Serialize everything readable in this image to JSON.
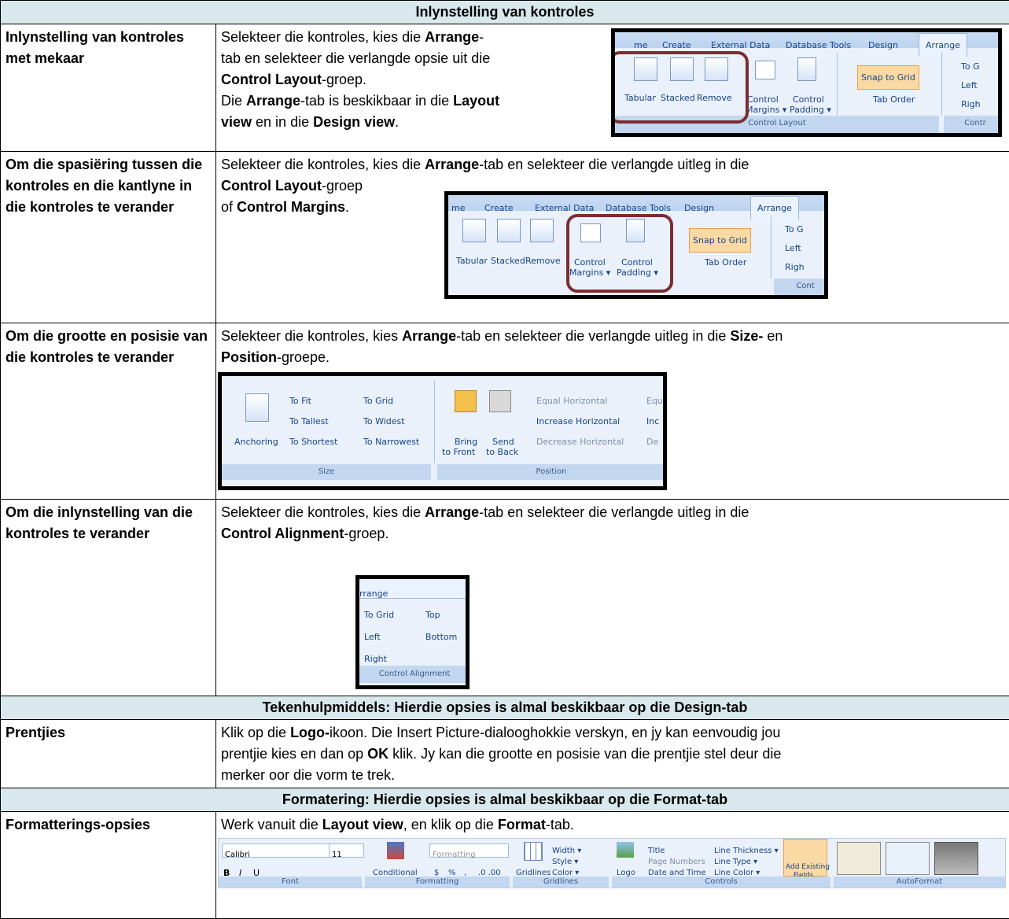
{
  "title": "Inlynstelling van kontroles",
  "rows": [
    {
      "label": "Inlynstelling van kontroles met mekaar",
      "lines": [
        [
          {
            "t": "Selekteer die kontroles, kies die "
          },
          {
            "t": "Arrange",
            "b": true
          },
          {
            "t": "-"
          }
        ],
        [
          {
            "t": "tab en selekteer die verlangde opsie uit die"
          }
        ],
        [
          {
            "t": "Control Layout",
            "b": true
          },
          {
            "t": "-groep."
          }
        ],
        [
          {
            "t": "Die "
          },
          {
            "t": "Arrange",
            "b": true
          },
          {
            "t": "-tab is beskikbaar in die "
          },
          {
            "t": "Layout",
            "b": true
          }
        ],
        [
          {
            "t": "view",
            "b": true
          },
          {
            "t": " en in die "
          },
          {
            "t": "Design view",
            "b": true
          },
          {
            "t": "."
          }
        ]
      ]
    },
    {
      "label": "Om die spasiëring tussen die kontroles en die kantlyne in die kontroles te verander",
      "lines": [
        [
          {
            "t": "Selekteer die kontroles, kies die "
          },
          {
            "t": "Arrange",
            "b": true
          },
          {
            "t": "-tab en selekteer die verlangde uitleg in die"
          }
        ],
        [
          {
            "t": "Control Layout",
            "b": true
          },
          {
            "t": "-groep"
          }
        ],
        [
          {
            "t": "of "
          },
          {
            "t": "Control Margins",
            "b": true
          },
          {
            "t": "."
          }
        ]
      ]
    },
    {
      "label": "Om die grootte en posisie van die kontroles te verander",
      "lines": [
        [
          {
            "t": "Selekteer die kontroles, kies "
          },
          {
            "t": "Arrange",
            "b": true
          },
          {
            "t": "-tab en selekteer die verlangde uitleg in die "
          },
          {
            "t": "Size-",
            "b": true
          },
          {
            "t": " en"
          }
        ],
        [
          {
            "t": "Position",
            "b": true
          },
          {
            "t": "-groepe."
          }
        ]
      ]
    },
    {
      "label": "Om die inlynstelling van die kontroles te verander",
      "lines": [
        [
          {
            "t": "Selekteer die kontroles, kies die "
          },
          {
            "t": "Arrange",
            "b": true
          },
          {
            "t": "-tab en selekteer die verlangde uitleg in die"
          }
        ],
        [
          {
            "t": "Control Alignment",
            "b": true
          },
          {
            "t": "-groep."
          }
        ]
      ]
    }
  ],
  "section2": {
    "title": "Tekenhulpmiddels: Hierdie opsies is almal beskikbaar op die Design-tab",
    "label": "Prentjies",
    "lines": [
      [
        {
          "t": "Klik op die "
        },
        {
          "t": "Logo-",
          "b": true
        },
        {
          "t": "ikoon. Die Insert Picture-dialooghokkie verskyn, en jy kan eenvoudig jou"
        }
      ],
      [
        {
          "t": "prentjie kies en dan op "
        },
        {
          "t": "OK",
          "b": true
        },
        {
          "t": " klik. Jy kan die grootte en posisie van die prentjie stel deur die"
        }
      ],
      [
        {
          "t": "merker oor die vorm te trek."
        }
      ]
    ]
  },
  "section3": {
    "title": "Formatering: Hierdie opsies is almal beskikbaar op die Format-tab",
    "label": "Formatterings-opsies",
    "lines": [
      [
        {
          "t": "Werk vanuit die "
        },
        {
          "t": "Layout view",
          "b": true
        },
        {
          "t": ", en klik op die "
        },
        {
          "t": "Format",
          "b": true
        },
        {
          "t": "-tab."
        }
      ]
    ]
  },
  "shot1": {
    "tabs": [
      "me",
      "Create",
      "External Data",
      "Database Tools",
      "Design",
      "Arrange"
    ],
    "buttons": [
      "Tabular",
      "Stacked",
      "Remove",
      "Control",
      "Margins ▾",
      "Control",
      "Padding ▾"
    ],
    "snap": "Snap to Grid",
    "taborder": "Tab Order",
    "right": [
      "To G",
      "Left",
      "Righ"
    ],
    "group": "Control Layout",
    "group2": "Contr"
  },
  "shot2": {
    "tabs": [
      "me",
      "Create",
      "External Data",
      "Database Tools",
      "Design",
      "Arrange"
    ],
    "buttons": [
      "Tabular",
      "Stacked",
      "Remove",
      "Control",
      "Margins ▾",
      "Control",
      "Padding ▾"
    ],
    "snap": "Snap to Grid",
    "taborder": "Tab Order",
    "right": [
      "To G",
      "Left",
      "Righ"
    ],
    "group": "Control Layout",
    "group2": "Cont"
  },
  "shot3": {
    "anchoring": "Anchoring",
    "size_items": [
      "To Fit",
      "To Tallest",
      "To Shortest",
      "To Grid",
      "To Widest",
      "To Narrowest"
    ],
    "bring": [
      "Bring",
      "to Front"
    ],
    "send": [
      "Send",
      "to Back"
    ],
    "pos_items": [
      "Equal Horizontal",
      "Increase Horizontal",
      "Decrease Horizontal",
      "Equ",
      "Inc",
      "De"
    ],
    "group_size": "Size",
    "group_pos": "Position"
  },
  "shot4": {
    "tab": "rrange",
    "items": [
      "To Grid",
      "Top",
      "Left",
      "Bottom",
      "Right"
    ],
    "group": "Control Alignment"
  },
  "shot5": {
    "font": "Calibri",
    "size": "11",
    "conditional": "Conditional",
    "formatting": "Formatting",
    "fmt_buttons": [
      "$",
      "%",
      ",",
      ".0 .00"
    ],
    "gridlines": "Gridlines",
    "grid_items": [
      "Width ▾",
      "Style ▾",
      "Color ▾"
    ],
    "logo": "Logo",
    "ctl_items": [
      "Title",
      "Page Numbers",
      "Date and Time",
      "Line Thickness ▾",
      "Line Type ▾",
      "Line Color ▾"
    ],
    "add_fields": [
      "Add Existing",
      "Fields"
    ],
    "groups": [
      "Font",
      "Formatting",
      "Gridlines",
      "Controls",
      "AutoFormat"
    ]
  },
  "colors": {
    "banner": "#d9e8ec",
    "highlight": "#7a2d32",
    "ribbon": "#eaf1fa"
  }
}
